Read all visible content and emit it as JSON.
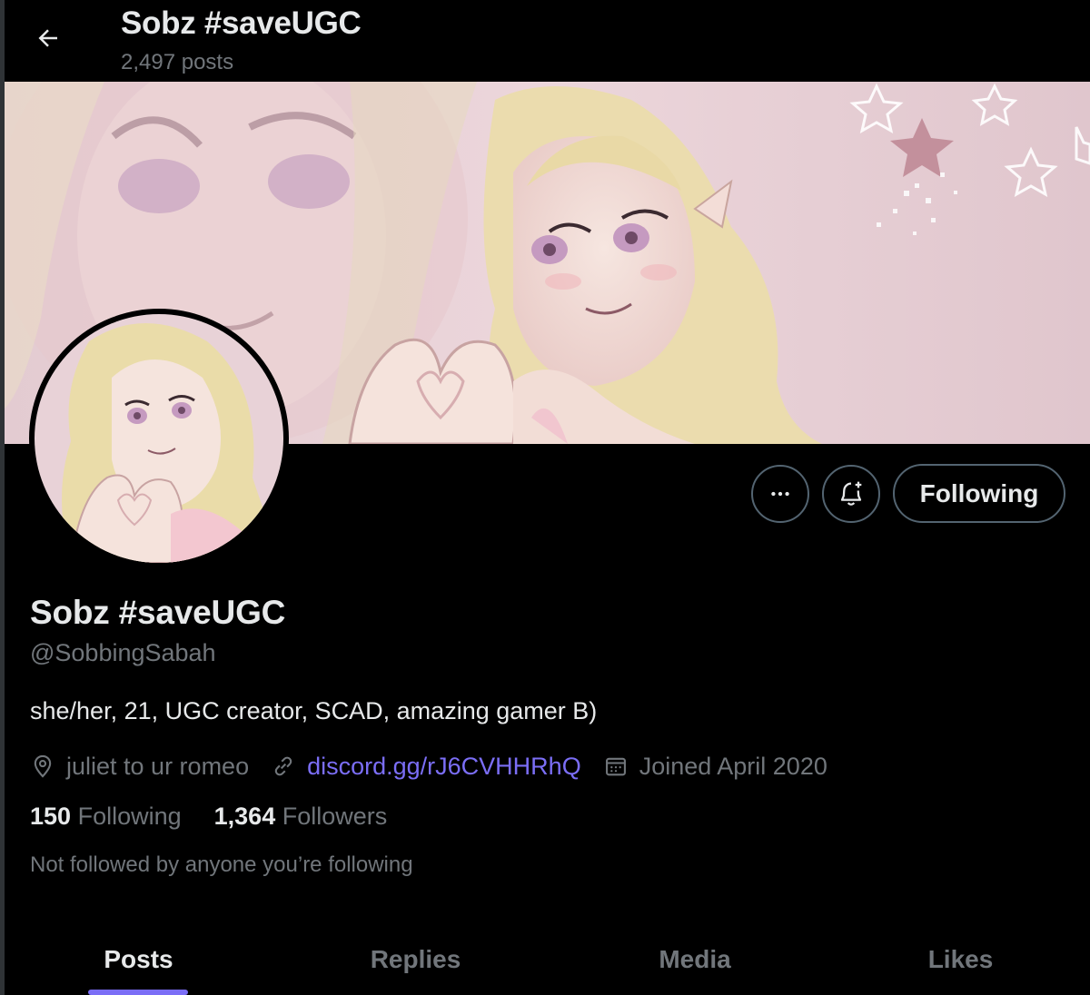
{
  "header": {
    "title": "Sobz #saveUGC",
    "post_count": "2,497 posts"
  },
  "profile": {
    "display_name": "Sobz #saveUGC",
    "handle": "@SobbingSabah",
    "bio": "she/her, 21, UGC creator, SCAD, amazing gamer B)",
    "location": "juliet to ur romeo",
    "link": "discord.gg/rJ6CVHHRhQ",
    "joined": "Joined April 2020",
    "following_count": "150",
    "following_label": "Following",
    "followers_count": "1,364",
    "followers_label": "Followers",
    "followed_by": "Not followed by anyone you’re following"
  },
  "actions": {
    "follow_state_label": "Following"
  },
  "tabs": [
    {
      "label": "Posts",
      "active": true
    },
    {
      "label": "Replies",
      "active": false
    },
    {
      "label": "Media",
      "active": false
    },
    {
      "label": "Likes",
      "active": false
    }
  ],
  "colors": {
    "accent": "#7b6ef6",
    "muted": "#71767b",
    "text": "#e7e9ea",
    "background": "#000000",
    "banner_pink": "#e8d2d7"
  },
  "icons": {
    "back": "arrow-left-icon",
    "more": "more-dots-icon",
    "notify": "bell-plus-icon",
    "location": "location-pin-icon",
    "link": "link-icon",
    "calendar": "calendar-icon"
  }
}
